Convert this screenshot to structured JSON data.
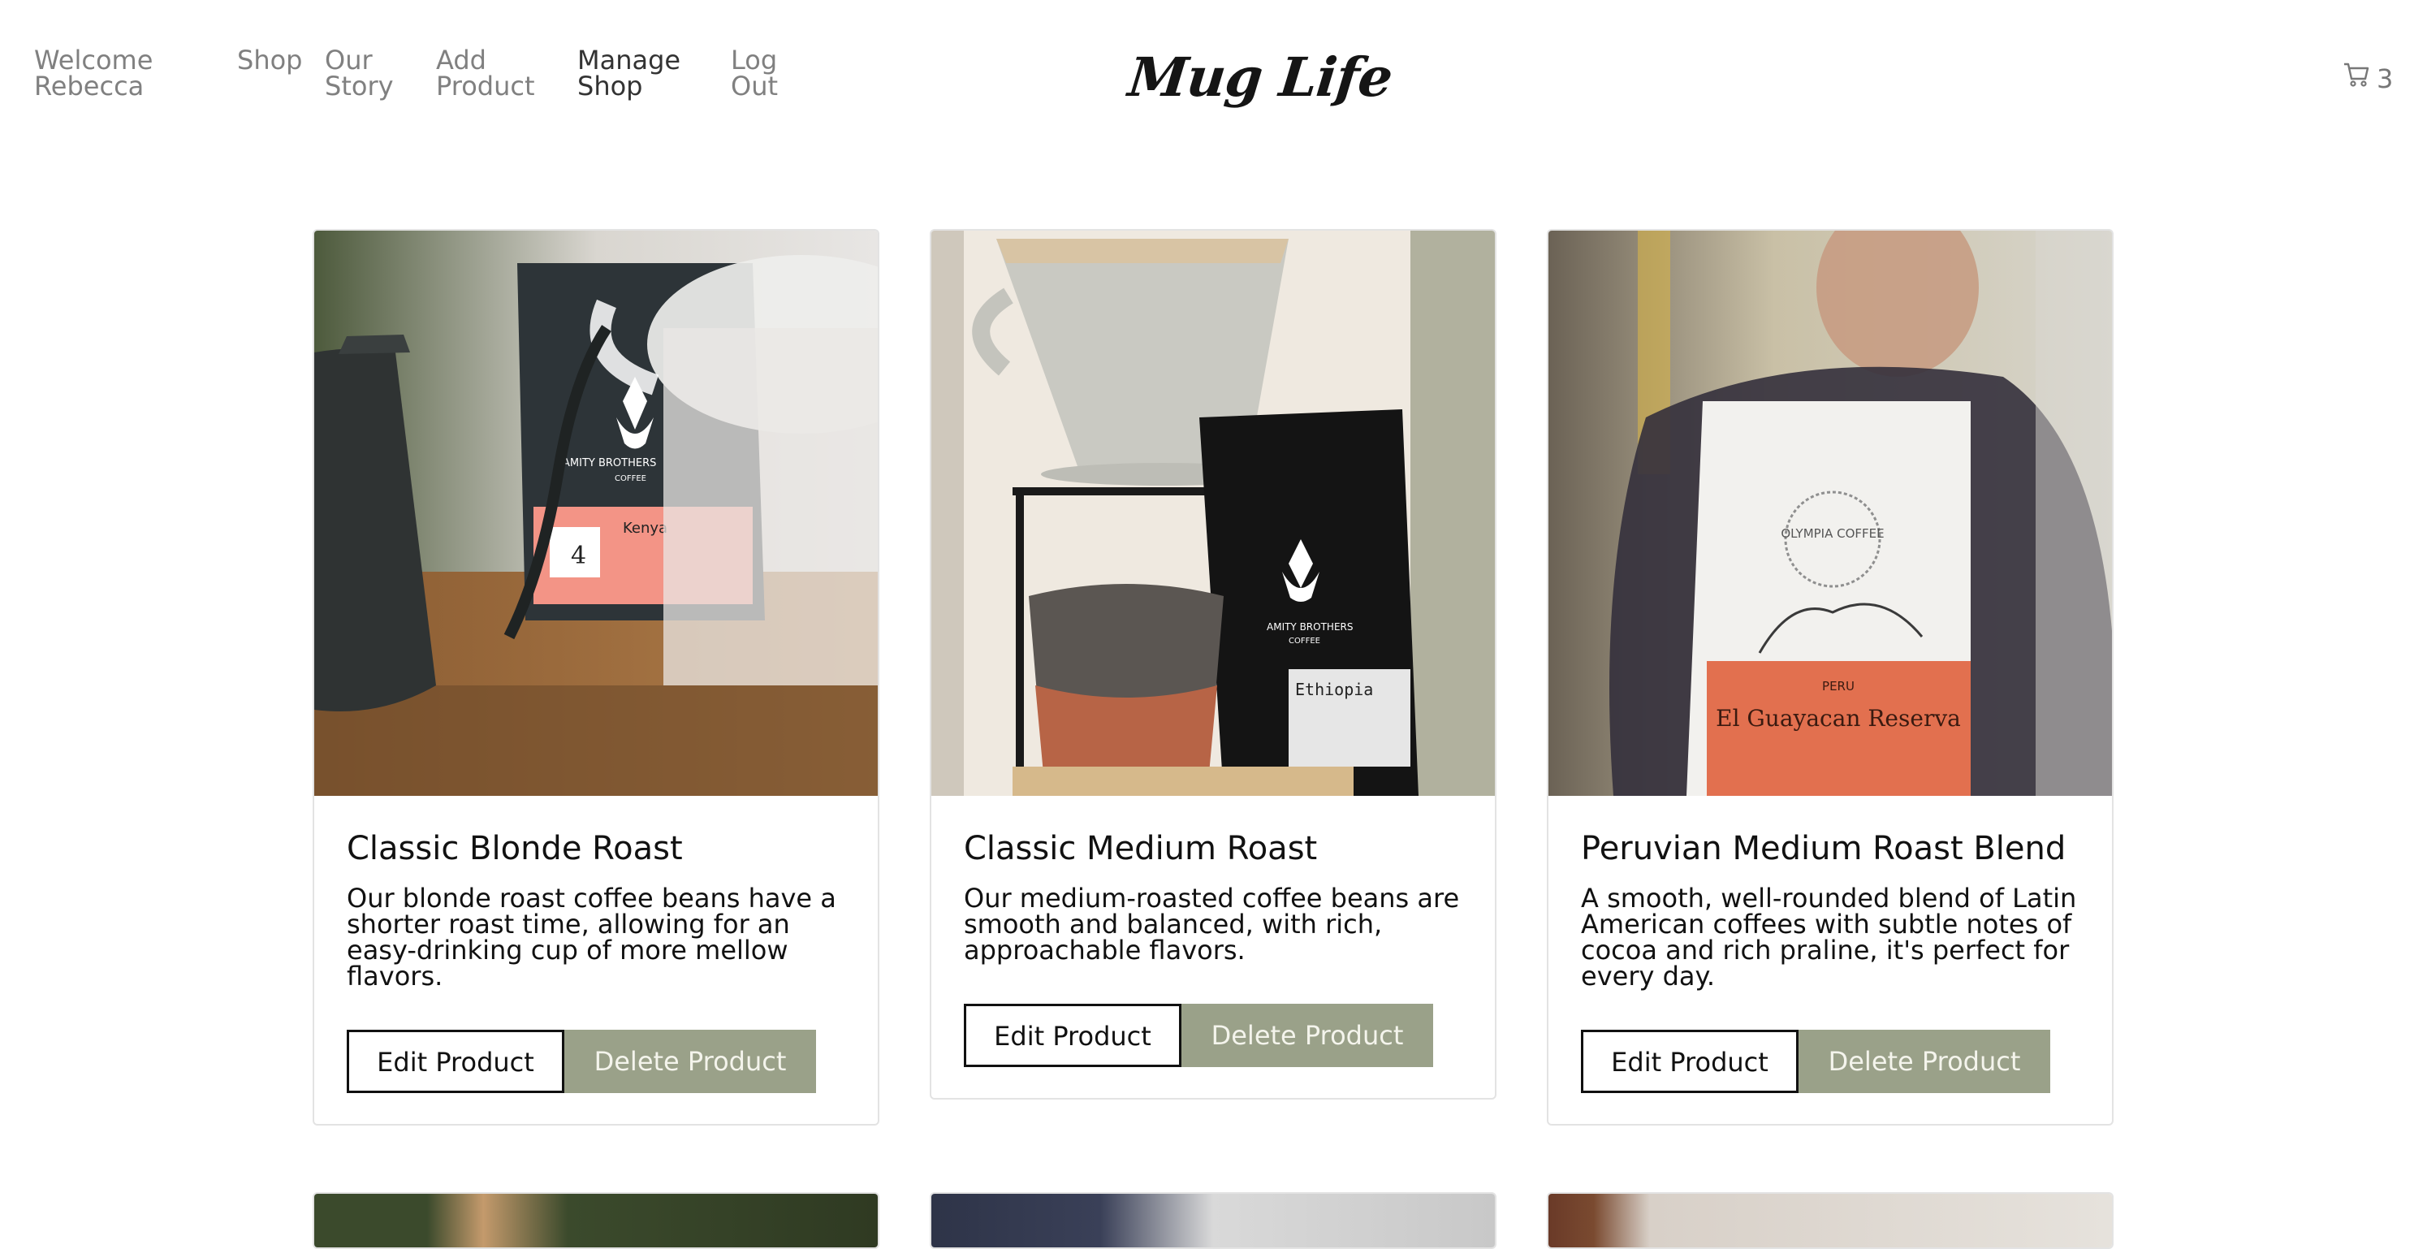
{
  "nav": {
    "welcome": [
      "Welcome",
      "Rebecca"
    ],
    "shop": "Shop",
    "our_story": [
      "Our",
      "Story"
    ],
    "add_product": [
      "Add",
      "Product"
    ],
    "manage_shop": [
      "Manage",
      "Shop"
    ],
    "log_out": [
      "Log",
      "Out"
    ]
  },
  "brand": {
    "logo": "Mug Life"
  },
  "cart": {
    "count": "3"
  },
  "products": [
    {
      "title": "Classic Blonde Roast",
      "description": "Our blonde roast coffee beans have a shorter roast time, allowing for an easy-drinking cup of more mellow flavors.",
      "edit_label": "Edit Product",
      "delete_label": "Delete Product",
      "image_text": {
        "brand": "AMITY BROTHERS",
        "sub": "COFFEE",
        "origin": "Kenya"
      }
    },
    {
      "title": "Classic Medium Roast",
      "description": "Our medium-roasted coffee beans are smooth and balanced, with rich, approachable flavors.",
      "edit_label": "Edit Product",
      "delete_label": "Delete Product",
      "image_text": {
        "brand": "AMITY BROTHERS",
        "sub": "COFFEE",
        "origin": "Ethiopia"
      }
    },
    {
      "title": "Peruvian Medium Roast Blend",
      "description": "A smooth, well-rounded blend of Latin American coffees with subtle notes of cocoa and rich praline, it's perfect for every day.",
      "edit_label": "Edit Product",
      "delete_label": "Delete Product",
      "image_text": {
        "brand": "OLYMPIA COFFEE",
        "country": "PERU",
        "name": "El Guayacan Reserva"
      }
    }
  ],
  "colors": {
    "delete_button": "#9aa189",
    "nav_text": "#808080"
  }
}
